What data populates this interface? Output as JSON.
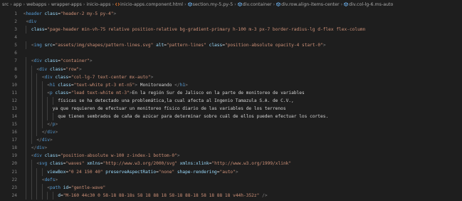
{
  "breadcrumb": [
    {
      "label": "src",
      "icon": ""
    },
    {
      "label": "app",
      "icon": ""
    },
    {
      "label": "webapps",
      "icon": ""
    },
    {
      "label": "wrapper-apps",
      "icon": ""
    },
    {
      "label": "inicio-apps",
      "icon": ""
    },
    {
      "label": "inicio-apps.component.html",
      "icon": "html-file-icon"
    },
    {
      "label": "section.my-5.py-5",
      "icon": "element-cube-icon"
    },
    {
      "label": "div.container",
      "icon": "element-cube-icon"
    },
    {
      "label": "div.row.align-items-center",
      "icon": "element-cube-icon"
    },
    {
      "label": "div.col-lg-6.ms-auto",
      "icon": "element-cube-icon"
    }
  ],
  "colors": {
    "background": "#1e1e1e",
    "line_number": "#858585",
    "tag": "#569cd6",
    "attribute": "#9cdcfe",
    "string": "#ce9178",
    "punctuation": "#808080",
    "text": "#d4d4d4"
  },
  "lines": [
    {
      "n": "1",
      "indent": 1,
      "tokens": [
        [
          "pun",
          "<"
        ],
        [
          "tag",
          "header"
        ],
        [
          "plain",
          " "
        ],
        [
          "attr",
          "class"
        ],
        [
          "plain",
          "="
        ],
        [
          "str",
          "\"header-2 my-5 py-4\""
        ],
        [
          "pun",
          ">"
        ]
      ]
    },
    {
      "n": "2",
      "indent": 2,
      "tokens": [
        [
          "pun",
          "<"
        ],
        [
          "tag",
          "div"
        ]
      ]
    },
    {
      "n": "3",
      "indent": 4,
      "tokens": [
        [
          "attr",
          "class"
        ],
        [
          "plain",
          "="
        ],
        [
          "str",
          "\"page-header min-vh-75 relative position-relative bg-gradient-primary h-100 m-3 px-7 border-radius-lg d-flex flex-column"
        ]
      ]
    },
    {
      "n": "4",
      "indent": 0,
      "tokens": []
    },
    {
      "n": "5",
      "indent": 4,
      "tokens": [
        [
          "pun",
          "<"
        ],
        [
          "tag",
          "img"
        ],
        [
          "plain",
          " "
        ],
        [
          "attr",
          "src"
        ],
        [
          "plain",
          "="
        ],
        [
          "str",
          "\"assets/img/shapes/pattern-lines.svg\""
        ],
        [
          "plain",
          " "
        ],
        [
          "attr",
          "alt"
        ],
        [
          "plain",
          "="
        ],
        [
          "str",
          "\"pattern-lines\""
        ],
        [
          "plain",
          " "
        ],
        [
          "attr",
          "class"
        ],
        [
          "plain",
          "="
        ],
        [
          "str",
          "\"position-absolute opacity-4 start-0\""
        ],
        [
          "pun",
          ">"
        ]
      ]
    },
    {
      "n": "6",
      "indent": 0,
      "tokens": []
    },
    {
      "n": "7",
      "indent": 4,
      "tokens": [
        [
          "pun",
          "<"
        ],
        [
          "tag",
          "div"
        ],
        [
          "plain",
          " "
        ],
        [
          "attr",
          "class"
        ],
        [
          "plain",
          "="
        ],
        [
          "str",
          "\"container\""
        ],
        [
          "pun",
          ">"
        ]
      ]
    },
    {
      "n": "8",
      "indent": 6,
      "tokens": [
        [
          "pun",
          "<"
        ],
        [
          "tag",
          "div"
        ],
        [
          "plain",
          " "
        ],
        [
          "attr",
          "class"
        ],
        [
          "plain",
          "="
        ],
        [
          "str",
          "\"row\""
        ],
        [
          "pun",
          ">"
        ]
      ]
    },
    {
      "n": "9",
      "indent": 8,
      "tokens": [
        [
          "pun",
          "<"
        ],
        [
          "tag",
          "div"
        ],
        [
          "plain",
          " "
        ],
        [
          "attr",
          "class"
        ],
        [
          "plain",
          "="
        ],
        [
          "str",
          "\"col-lg-7 text-center mx-auto\""
        ],
        [
          "pun",
          ">"
        ]
      ]
    },
    {
      "n": "10",
      "indent": 10,
      "tokens": [
        [
          "pun",
          "<"
        ],
        [
          "tag",
          "h1"
        ],
        [
          "plain",
          " "
        ],
        [
          "attr",
          "class"
        ],
        [
          "plain",
          "="
        ],
        [
          "str",
          "\"text-white pt-3 mt-n5\""
        ],
        [
          "pun",
          ">"
        ],
        [
          "plain",
          " Monitoreando "
        ],
        [
          "pun",
          "</"
        ],
        [
          "tag",
          "h1"
        ],
        [
          "pun",
          ">"
        ]
      ]
    },
    {
      "n": "11",
      "indent": 10,
      "tokens": [
        [
          "pun",
          "<"
        ],
        [
          "tag",
          "p"
        ],
        [
          "plain",
          " "
        ],
        [
          "attr",
          "class"
        ],
        [
          "plain",
          "="
        ],
        [
          "str",
          "\"lead text-white mt-3\""
        ],
        [
          "pun",
          ">"
        ],
        [
          "plain",
          "En la región Sur de Jalisco en la parte de monitoreo de variables"
        ]
      ]
    },
    {
      "n": "12",
      "indent": 14,
      "tokens": [
        [
          "plain",
          "físicas se ha detectado una problemática,la cual afecta al Ingenio Tamazula S.A. de C.V.,"
        ]
      ]
    },
    {
      "n": "13",
      "indent": 12,
      "tokens": [
        [
          "plain",
          "ya que requieren de efectuar un monitoreo físico diario de las variables de los terrenos"
        ]
      ]
    },
    {
      "n": "14",
      "indent": 14,
      "tokens": [
        [
          "plain",
          "que tienen sembrados de caña de azúcar para determinar sobre cuál de ellos pueden efectuar los cortes."
        ]
      ]
    },
    {
      "n": "15",
      "indent": 10,
      "tokens": [
        [
          "pun",
          "</"
        ],
        [
          "tag",
          "p"
        ],
        [
          "pun",
          ">"
        ]
      ]
    },
    {
      "n": "16",
      "indent": 8,
      "tokens": [
        [
          "pun",
          "</"
        ],
        [
          "tag",
          "div"
        ],
        [
          "pun",
          ">"
        ]
      ]
    },
    {
      "n": "17",
      "indent": 6,
      "tokens": [
        [
          "pun",
          "</"
        ],
        [
          "tag",
          "div"
        ],
        [
          "pun",
          ">"
        ]
      ]
    },
    {
      "n": "18",
      "indent": 4,
      "tokens": [
        [
          "pun",
          "</"
        ],
        [
          "tag",
          "div"
        ],
        [
          "pun",
          ">"
        ]
      ]
    },
    {
      "n": "19",
      "indent": 4,
      "tokens": [
        [
          "pun",
          "<"
        ],
        [
          "tag",
          "div"
        ],
        [
          "plain",
          " "
        ],
        [
          "attr",
          "class"
        ],
        [
          "plain",
          "="
        ],
        [
          "str",
          "\"position-absolute w-100 z-index-1 bottom-0\""
        ],
        [
          "pun",
          ">"
        ]
      ]
    },
    {
      "n": "20",
      "indent": 6,
      "tokens": [
        [
          "pun",
          "<"
        ],
        [
          "tag",
          "svg"
        ],
        [
          "plain",
          " "
        ],
        [
          "attr",
          "class"
        ],
        [
          "plain",
          "="
        ],
        [
          "str",
          "\"waves\""
        ],
        [
          "plain",
          " "
        ],
        [
          "attr",
          "xmlns"
        ],
        [
          "plain",
          "="
        ],
        [
          "str",
          "\"http://www.w3.org/2000/svg\""
        ],
        [
          "plain",
          " "
        ],
        [
          "attr",
          "xmlns:xlink"
        ],
        [
          "plain",
          "="
        ],
        [
          "str",
          "\"http://www.w3.org/1999/xlink\""
        ]
      ]
    },
    {
      "n": "21",
      "indent": 10,
      "tokens": [
        [
          "attr",
          "viewBox"
        ],
        [
          "plain",
          "="
        ],
        [
          "str",
          "\"0 24 150 40\""
        ],
        [
          "plain",
          " "
        ],
        [
          "attr",
          "preserveAspectRatio"
        ],
        [
          "plain",
          "="
        ],
        [
          "str",
          "\"none\""
        ],
        [
          "plain",
          " "
        ],
        [
          "attr",
          "shape-rendering"
        ],
        [
          "plain",
          "="
        ],
        [
          "str",
          "\"auto\""
        ],
        [
          "pun",
          ">"
        ]
      ]
    },
    {
      "n": "22",
      "indent": 8,
      "tokens": [
        [
          "pun",
          "<"
        ],
        [
          "tag",
          "defs"
        ],
        [
          "pun",
          ">"
        ]
      ]
    },
    {
      "n": "23",
      "indent": 10,
      "tokens": [
        [
          "pun",
          "<"
        ],
        [
          "tag",
          "path"
        ],
        [
          "plain",
          " "
        ],
        [
          "attr",
          "id"
        ],
        [
          "plain",
          "="
        ],
        [
          "str",
          "\"gentle-wave\""
        ]
      ]
    },
    {
      "n": "24",
      "indent": 14,
      "tokens": [
        [
          "attr",
          "d"
        ],
        [
          "plain",
          "="
        ],
        [
          "str",
          "\"M-160 44c30 0 58-18 88-18s 58 18 88 18 58-18 88-18 58 18 88 18 v44h-352z\""
        ],
        [
          "plain",
          " "
        ],
        [
          "pun",
          "/>"
        ]
      ]
    }
  ]
}
